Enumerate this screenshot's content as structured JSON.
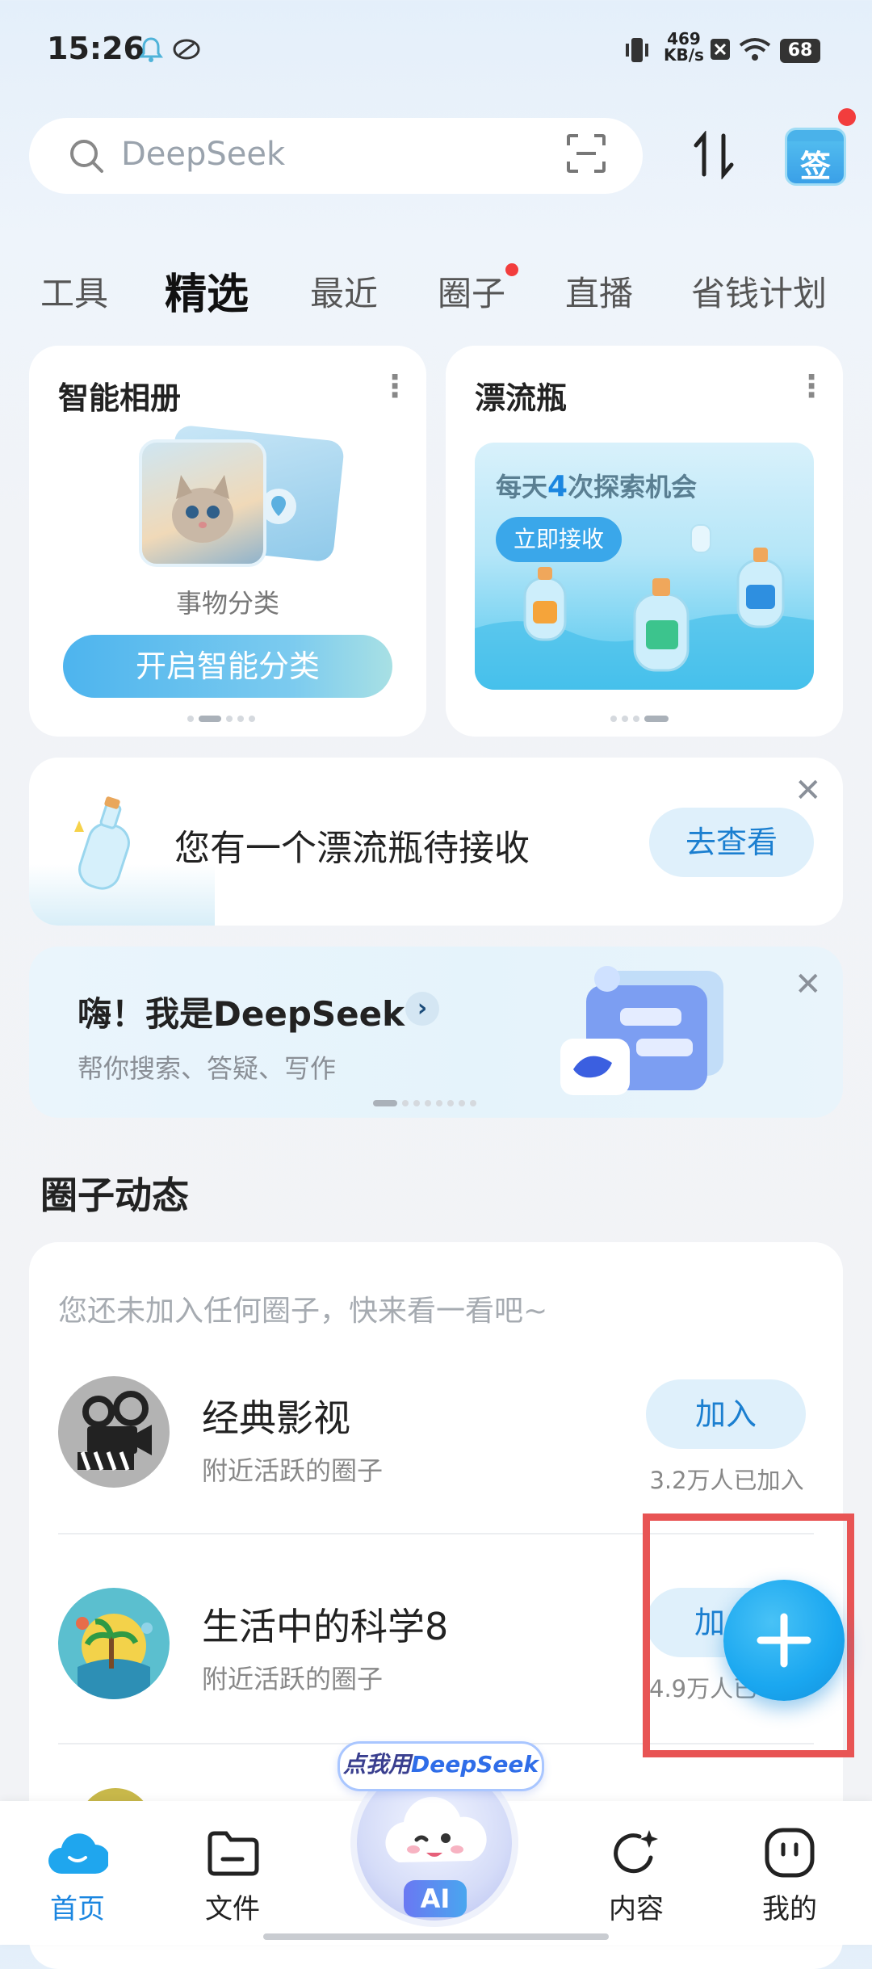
{
  "status": {
    "time": "15:26",
    "net_speed_top": "469",
    "net_speed_bottom": "KB/s",
    "battery": "68"
  },
  "search": {
    "placeholder": "DeepSeek"
  },
  "header": {
    "sign_label": "签"
  },
  "tabs": [
    {
      "label": "工具"
    },
    {
      "label": "精选",
      "active": true
    },
    {
      "label": "最近"
    },
    {
      "label": "圈子",
      "badge": true
    },
    {
      "label": "直播"
    },
    {
      "label": "省钱计划"
    }
  ],
  "album_card": {
    "title": "智能相册",
    "caption": "事物分类",
    "button": "开启智能分类"
  },
  "bottle_card": {
    "title": "漂流瓶",
    "banner_prefix": "每天",
    "banner_num": "4",
    "banner_suffix": "次探索机会",
    "button": "立即接收"
  },
  "bottle_notice": {
    "text": "您有一个漂流瓶待接收",
    "button": "去查看"
  },
  "deepseek_banner": {
    "title": "嗨！我是DeepSeek",
    "subtitle": "帮你搜索、答疑、写作"
  },
  "circles": {
    "section_title": "圈子动态",
    "empty_hint": "您还未加入任何圈子，快来看一看吧~",
    "items": [
      {
        "name": "经典影视",
        "sub": "附近活跃的圈子",
        "button": "加入",
        "count": "3.2万人已加入"
      },
      {
        "name": "生活中的科学8",
        "sub": "附近活跃的圈子",
        "button": "加",
        "count": "4.9万人已"
      }
    ]
  },
  "ai_bubble": {
    "prefix": "点我用",
    "brand": "DeepSeek",
    "center_label": "AI"
  },
  "bottom_nav": [
    {
      "label": "首页",
      "active": true
    },
    {
      "label": "文件"
    },
    {
      "label": "内容"
    },
    {
      "label": "我的"
    }
  ],
  "colors": {
    "accent": "#1b86e0",
    "highlight": "#e85454",
    "fab": "#1aa7f0"
  }
}
